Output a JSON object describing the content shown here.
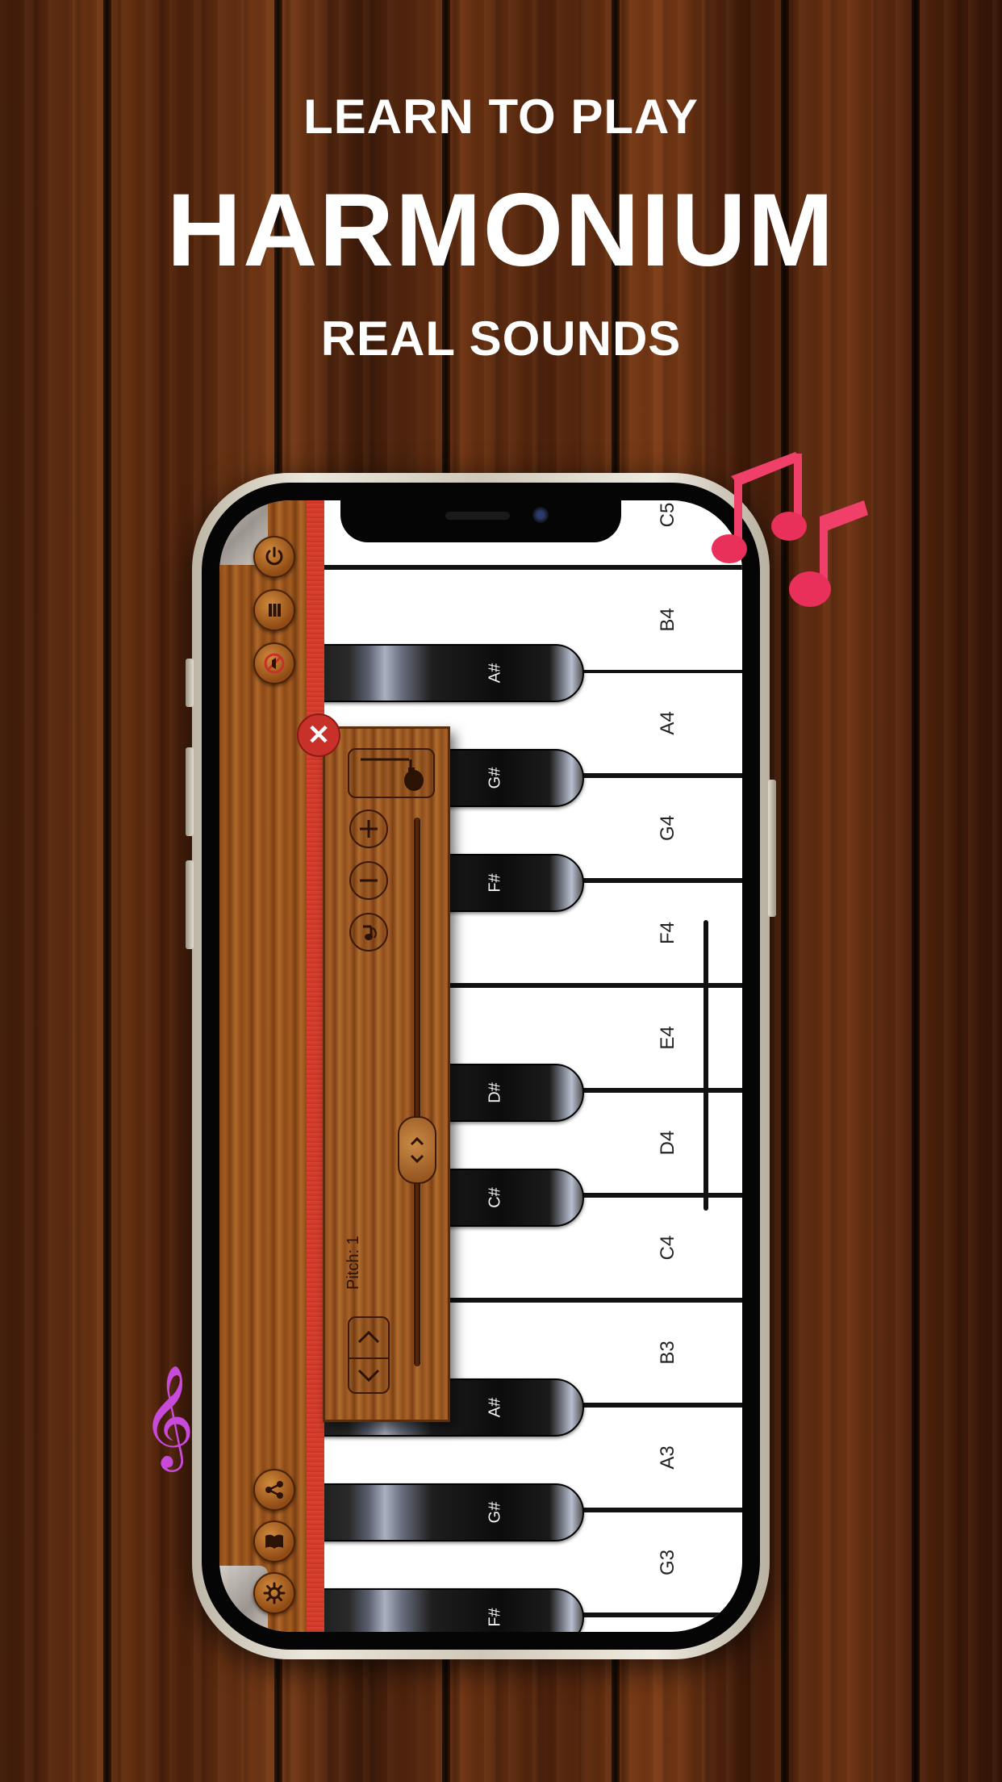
{
  "headline": {
    "line1": "LEARN TO PLAY",
    "line2": "HARMONIUM",
    "line3": "REAL SOUNDS"
  },
  "keyboard": {
    "white_keys": [
      "C5",
      "B4",
      "A4",
      "G4",
      "F4",
      "E4",
      "D4",
      "C4",
      "B3",
      "A3",
      "G3"
    ],
    "black_keys": [
      "A#",
      "G#",
      "F#",
      "D#",
      "C#",
      "A#",
      "G#",
      "F#"
    ]
  },
  "panel": {
    "pitch_label": "Pitch: 1"
  },
  "icons": {
    "power": "power-icon",
    "pause": "pause-icon",
    "mute": "mute-icon",
    "share": "share-icon",
    "book": "book-icon",
    "settings": "gear-icon"
  },
  "colors": {
    "accent_red": "#d53a2a",
    "note_pink": "#f0406a",
    "treble_purple": "#c84ad8"
  }
}
